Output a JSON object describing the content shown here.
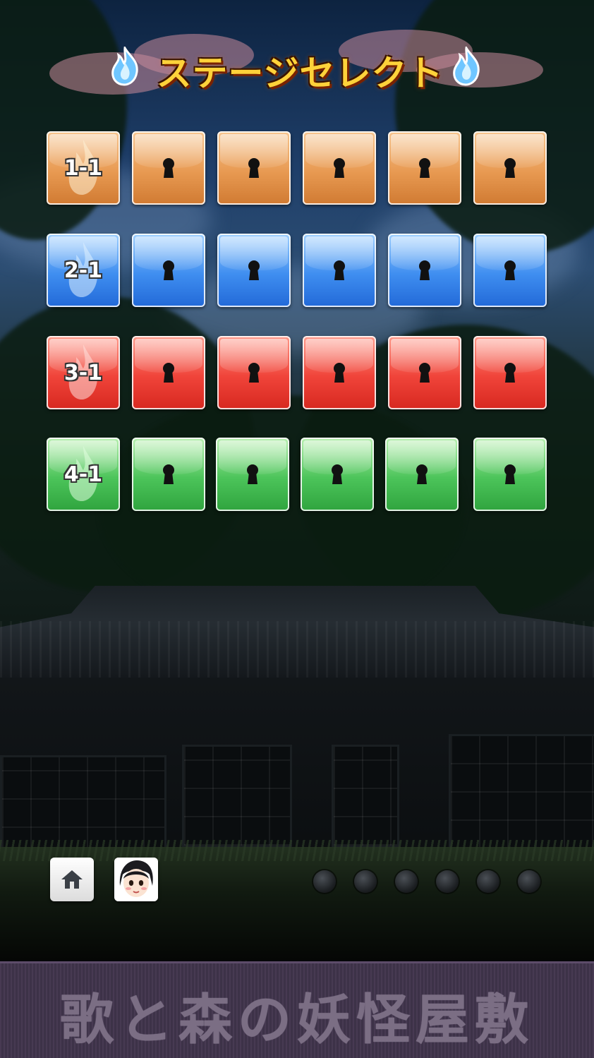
{
  "title": "ステージセレクト",
  "rows": [
    {
      "color": "orange",
      "first_label": "1-1"
    },
    {
      "color": "blue",
      "first_label": "2-1"
    },
    {
      "color": "red",
      "first_label": "3-1"
    },
    {
      "color": "green",
      "first_label": "4-1"
    }
  ],
  "tile_colors": {
    "orange": "#e89a52",
    "blue": "#3f8ef0",
    "red": "#f0443a",
    "green": "#4cc45a"
  },
  "locked_icon": "keyhole-icon",
  "locked_per_row": 5,
  "bottom_bar": {
    "home_icon": "home-icon",
    "character_icon": "character-avatar-icon",
    "page_indicators": 6
  },
  "banner": {
    "text": "歌と森の妖怪屋敷"
  }
}
